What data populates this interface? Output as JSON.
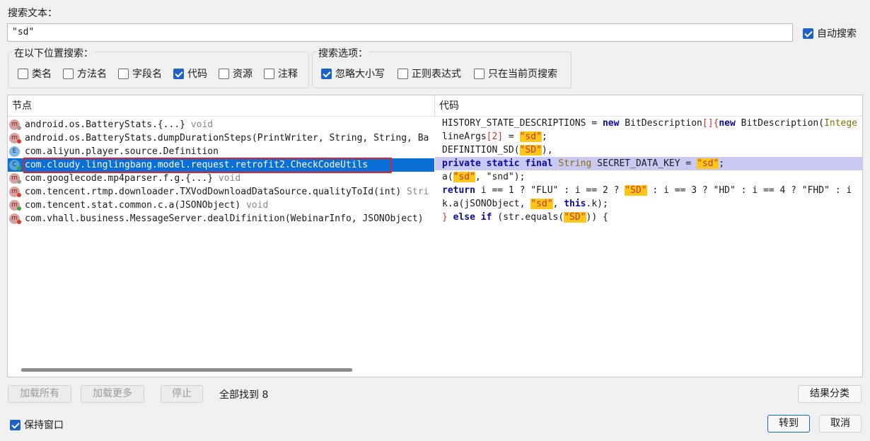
{
  "search": {
    "label": "搜索文本：",
    "value": "\"sd\"",
    "auto_search_label": "自动搜索",
    "auto_search_checked": true
  },
  "location": {
    "title": "在以下位置搜索：",
    "options": [
      {
        "label": "类名",
        "checked": false
      },
      {
        "label": "方法名",
        "checked": false
      },
      {
        "label": "字段名",
        "checked": false
      },
      {
        "label": "代码",
        "checked": true
      },
      {
        "label": "资源",
        "checked": false
      },
      {
        "label": "注释",
        "checked": false
      }
    ]
  },
  "options": {
    "title": "搜索选项：",
    "items": [
      {
        "label": "忽略大小写",
        "checked": true
      },
      {
        "label": "正则表达式",
        "checked": false
      },
      {
        "label": "只在当前页搜索",
        "checked": false
      }
    ]
  },
  "results": {
    "col_node": "节点",
    "col_code": "代码",
    "rows": [
      {
        "icon": "m",
        "name": "android.os.BatteryStats.{...}",
        "suffix": " void",
        "code": ""
      },
      {
        "icon": "m",
        "name": "android.os.BatteryStats.dumpDurationSteps(PrintWriter, String, String, Ba",
        "suffix": "",
        "code": ""
      },
      {
        "icon": "e",
        "name": "com.aliyun.player.source.Definition",
        "suffix": "",
        "code": ""
      },
      {
        "icon": "c",
        "name": "com.cloudy.linglingbang.model.request.retrofit2.CheckCodeUtils",
        "suffix": "",
        "code": ""
      },
      {
        "icon": "m",
        "name": "com.googlecode.mp4parser.f.g.{...}",
        "suffix": " void",
        "code": ""
      },
      {
        "icon": "m",
        "name": "com.tencent.rtmp.downloader.TXVodDownloadDataSource.qualityToId(int)",
        "suffix": " Stri",
        "code": ""
      },
      {
        "icon": "m",
        "name": "com.tencent.stat.common.c.a(JSONObject)",
        "suffix": " void",
        "code": ""
      },
      {
        "icon": "m",
        "name": "com.vhall.business.MessageServer.dealDifinition(WebinarInfo, JSONObject)",
        "suffix": "",
        "code": ""
      }
    ],
    "code_lines": [
      {
        "a": "HISTORY_STATE_DESCRIPTIONS = ",
        "kw1": "new",
        "b": " BitDescription",
        "red": "[]{",
        "kw2": "new",
        "c": " BitDescription(",
        "typ": "Intege"
      },
      {
        "a": "lineArgs",
        "red": "[2]",
        "b": " = ",
        "mark": "\"sd\"",
        "c": ";"
      },
      {
        "a": "DEFINITION_SD(",
        "mark": "\"SD\"",
        "b": "),"
      },
      {
        "kw": "private static final",
        "typ": " String",
        "a": " SECRET_DATA_KEY = ",
        "mark": "\"sd\"",
        "b": ";"
      },
      {
        "a": "a(",
        "mark": "\"sd\"",
        "b": ", \"snd\");"
      },
      {
        "kw": "return",
        "a": " i == 1 ? \"FLU\" : i == 2 ? ",
        "mark": "\"SD\"",
        "b": " : i == 3 ? \"HD\" : i == 4 ? \"FHD\" : i"
      },
      {
        "a": "k.a(jSONObject, ",
        "mark": "\"sd\"",
        "b": ", ",
        "kw": "this",
        "c": ".k);"
      },
      {
        "red": "} ",
        "kw": "else if",
        "a": " (str.equals(",
        "mark": "\"SD\"",
        "b": ")) {"
      }
    ]
  },
  "buttons": {
    "load_all": "加载所有",
    "load_more": "加载更多",
    "stop": "停止",
    "found": "全部找到 8",
    "group_results": "结果分类",
    "keep_window": "保持窗口",
    "goto": "转到",
    "cancel": "取消"
  }
}
